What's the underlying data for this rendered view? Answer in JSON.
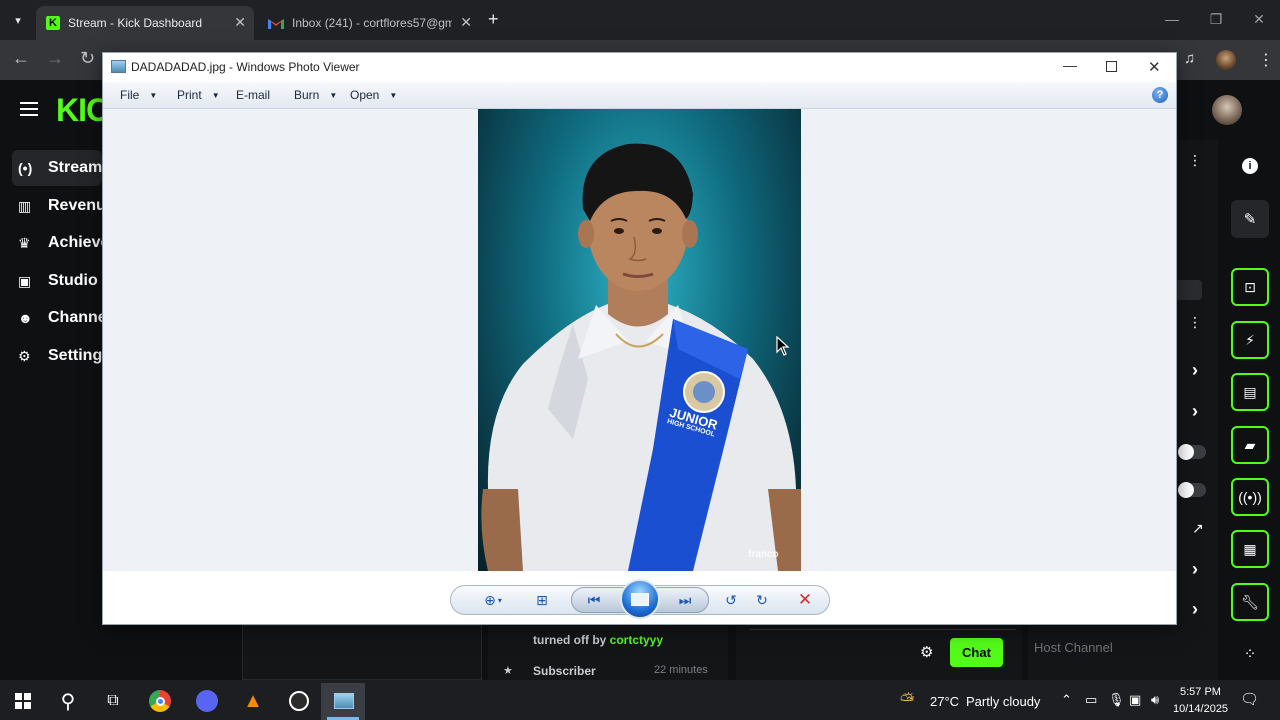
{
  "browser": {
    "tabs": [
      {
        "title": "Stream - Kick Dashboard",
        "active": true
      },
      {
        "title": "Inbox (241) - cortflores57@gm",
        "active": false
      }
    ],
    "new_tab_symbol": "+"
  },
  "kick": {
    "logo": "KIC",
    "sidebar": [
      {
        "label": "Stream",
        "icon": "broadcast-icon"
      },
      {
        "label": "Revenue",
        "icon": "chart-icon"
      },
      {
        "label": "Achieve",
        "icon": "trophy-icon"
      },
      {
        "label": "Studio",
        "icon": "camera-icon"
      },
      {
        "label": "Channel",
        "icon": "users-icon"
      },
      {
        "label": "Settings",
        "icon": "gear-icon"
      }
    ],
    "activity": {
      "turned_off_by_prefix": "turned off by",
      "turned_off_by_user": "cortctyyy",
      "subscriber_label": "Subscriber",
      "time_ago": "22 minutes"
    },
    "chat_button": "Chat",
    "host_channel": "Host Channel",
    "accent_color": "#53fc18"
  },
  "viewer": {
    "title": "DADADADAD.jpg - Windows Photo Viewer",
    "menu": [
      {
        "label": "File",
        "has_dropdown": true
      },
      {
        "label": "Print",
        "has_dropdown": true
      },
      {
        "label": "E-mail",
        "has_dropdown": false
      },
      {
        "label": "Burn",
        "has_dropdown": true
      },
      {
        "label": "Open",
        "has_dropdown": true
      }
    ],
    "photo": {
      "sash_line1": "JUNIOR",
      "sash_line2": "HIGH SCHOOL",
      "watermark": "franco"
    }
  },
  "taskbar": {
    "weather_temp": "27°C",
    "weather_text": "Partly cloudy",
    "time": "5:57 PM",
    "date": "10/14/2025"
  }
}
